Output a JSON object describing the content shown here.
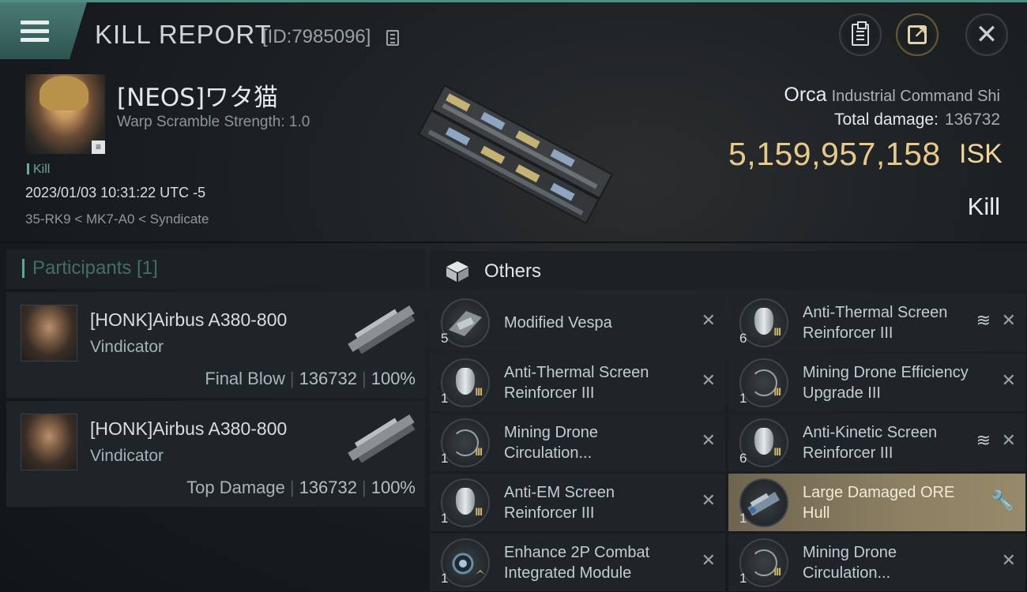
{
  "header": {
    "title": "KILL REPORT",
    "report_id": "[ID:7985096]"
  },
  "victim": {
    "name": "[NEOS]ワタ猫",
    "stat": "Warp Scramble Strength: 1.0",
    "tag": "Kill",
    "datetime": "2023/01/03 10:31:22 UTC -5",
    "location": "35-RK9 < MK7-A0 < Syndicate"
  },
  "summary": {
    "ship_name": "Orca",
    "ship_class": "Industrial Command Shi",
    "damage_label": "Total damage:",
    "damage_value": "136732",
    "isk_value": "5,159,957,158",
    "isk_unit": "ISK",
    "result": "Kill"
  },
  "participants": {
    "header": "Participants [1]",
    "rows": [
      {
        "name": "[HONK]Airbus A380-800",
        "ship": "Vindicator",
        "role": "Final Blow",
        "damage": "136732",
        "percent": "100%"
      },
      {
        "name": "[HONK]Airbus A380-800",
        "ship": "Vindicator",
        "role": "Top Damage",
        "damage": "136732",
        "percent": "100%"
      }
    ]
  },
  "others": {
    "header": "Others",
    "left": [
      {
        "name": "Modified Vespa",
        "qty": "5"
      },
      {
        "name": "Anti-Thermal Screen Reinforcer III",
        "qty": "1",
        "rank": "III"
      },
      {
        "name": "Mining Drone Circulation...",
        "qty": "1",
        "rank": "III"
      },
      {
        "name": "Anti-EM Screen Reinforcer III",
        "qty": "1",
        "rank": "III"
      },
      {
        "name": "Enhance 2P Combat Integrated Module",
        "qty": "1"
      }
    ],
    "right": [
      {
        "name": "Anti-Thermal Screen Reinforcer III",
        "qty": "6",
        "rank": "III"
      },
      {
        "name": "Mining Drone Efficiency Upgrade III",
        "qty": "1",
        "rank": "III"
      },
      {
        "name": "Anti-Kinetic Screen Reinforcer III",
        "qty": "6",
        "rank": "III"
      },
      {
        "name": "Large Damaged ORE Hull",
        "qty": "1"
      },
      {
        "name": "Mining Drone Circulation...",
        "qty": "1",
        "rank": "III"
      }
    ]
  },
  "colors": {
    "accent": "#4f8f86",
    "isk": "#e9c98a",
    "highlight_row": "#8d8063"
  }
}
